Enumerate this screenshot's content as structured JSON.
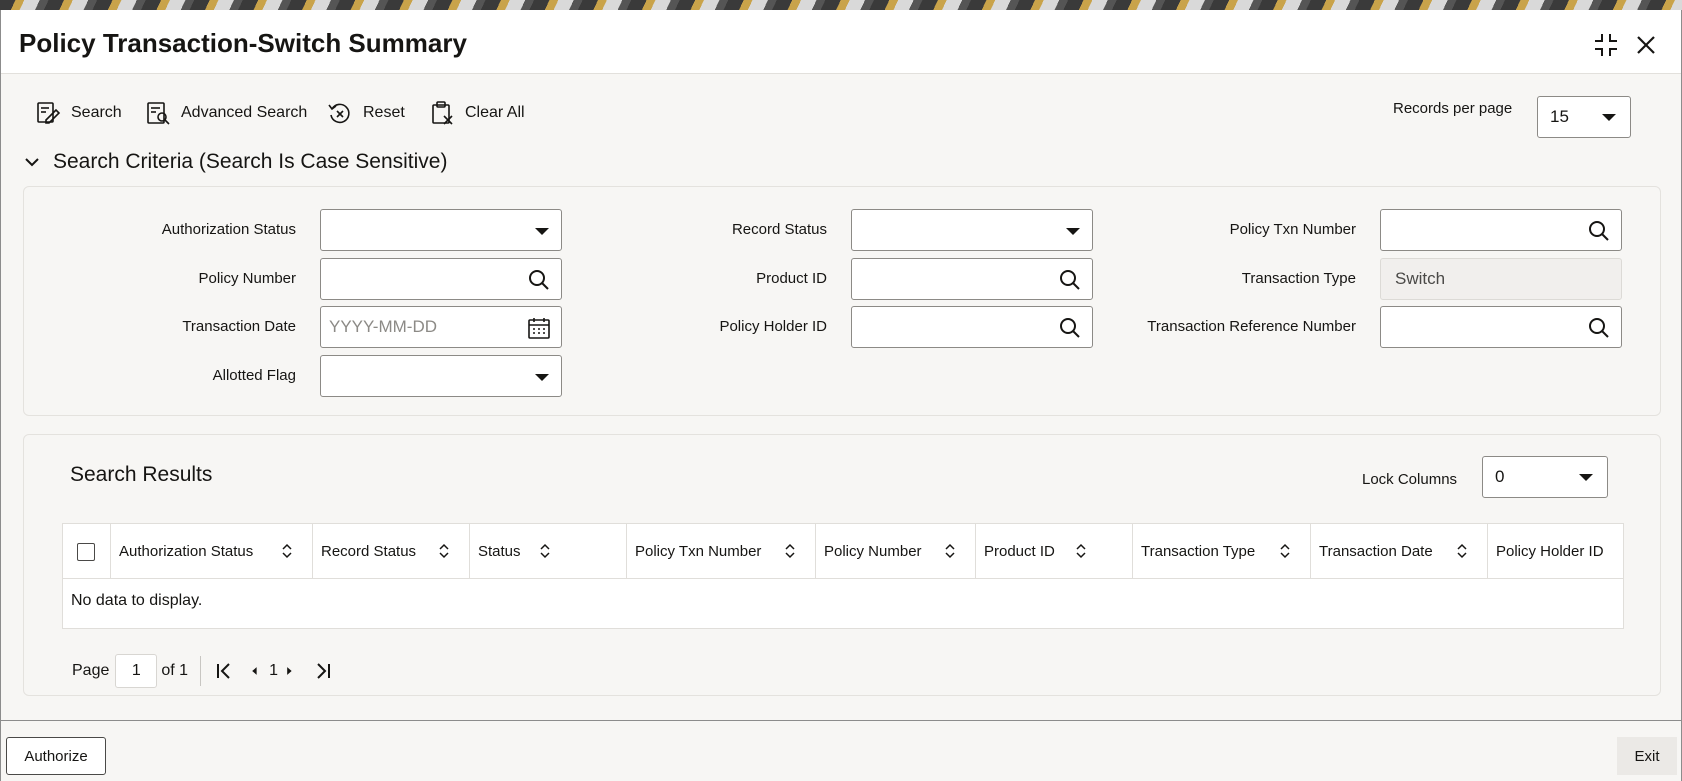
{
  "window": {
    "title": "Policy Transaction-Switch Summary"
  },
  "toolbar": {
    "search_label": "Search",
    "advanced_search_label": "Advanced Search",
    "reset_label": "Reset",
    "clear_all_label": "Clear All",
    "records_per_page_label": "Records per page",
    "records_per_page_value": "15"
  },
  "criteria": {
    "heading": "Search Criteria (Search Is Case Sensitive)",
    "authorization_status_label": "Authorization Status",
    "authorization_status_value": "",
    "record_status_label": "Record Status",
    "record_status_value": "",
    "policy_txn_number_label": "Policy Txn Number",
    "policy_txn_number_value": "",
    "policy_number_label": "Policy Number",
    "policy_number_value": "",
    "product_id_label": "Product ID",
    "product_id_value": "",
    "transaction_type_label": "Transaction Type",
    "transaction_type_value": "Switch",
    "transaction_date_label": "Transaction Date",
    "transaction_date_placeholder": "YYYY-MM-DD",
    "policy_holder_id_label": "Policy Holder ID",
    "policy_holder_id_value": "",
    "transaction_reference_number_label": "Transaction Reference Number",
    "transaction_reference_number_value": "",
    "allotted_flag_label": "Allotted Flag",
    "allotted_flag_value": ""
  },
  "results": {
    "heading": "Search Results",
    "lock_columns_label": "Lock Columns",
    "lock_columns_value": "0",
    "columns": [
      "Authorization Status",
      "Record Status",
      "Status",
      "Policy Txn Number",
      "Policy Number",
      "Product ID",
      "Transaction Type",
      "Transaction Date",
      "Policy Holder ID"
    ],
    "empty_message": "No data to display."
  },
  "pagination": {
    "page_label": "Page",
    "current_page": "1",
    "of_label": "of 1",
    "page_number": "1"
  },
  "footer": {
    "authorize_label": "Authorize",
    "exit_label": "Exit"
  },
  "colors": {
    "background": "#f7f6f4",
    "text": "#161513",
    "border": "#8c8a86"
  }
}
